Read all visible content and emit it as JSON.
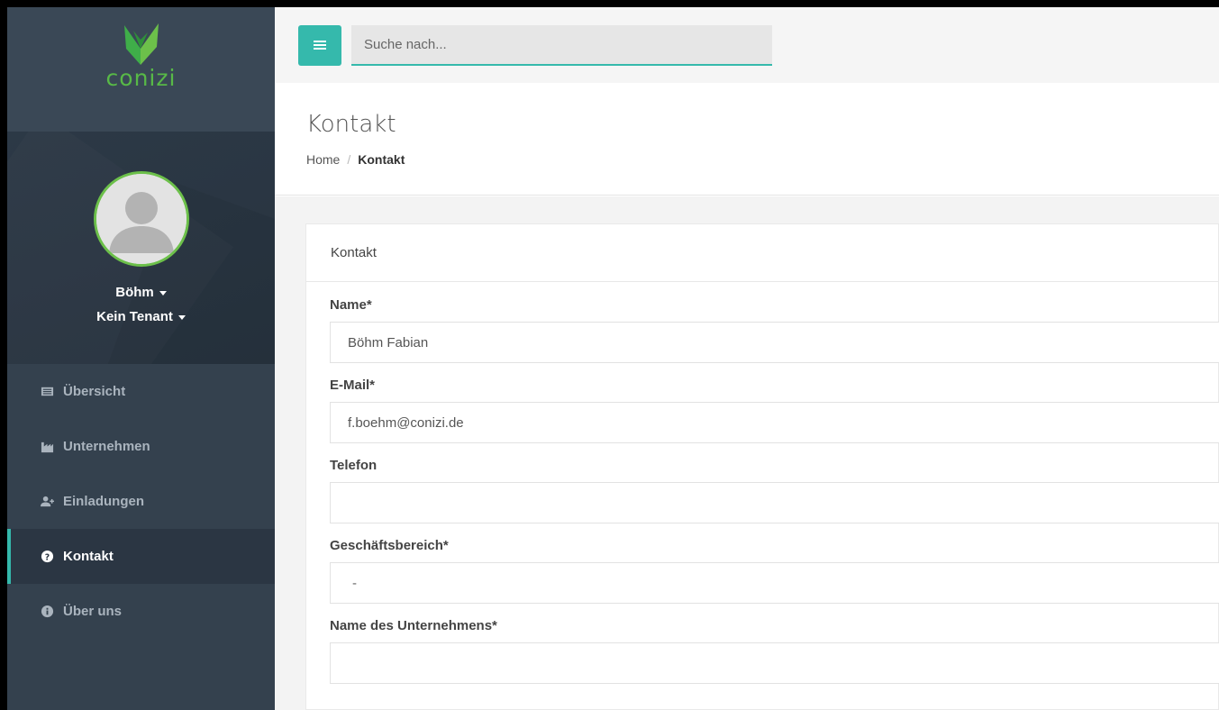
{
  "brand": {
    "name": "conizi"
  },
  "profile": {
    "name": "Böhm",
    "tenant": "Kein Tenant"
  },
  "sidebar": {
    "items": [
      {
        "label": "Übersicht",
        "icon": "list-icon",
        "active": false
      },
      {
        "label": "Unternehmen",
        "icon": "industry-icon",
        "active": false
      },
      {
        "label": "Einladungen",
        "icon": "user-plus-icon",
        "active": false
      },
      {
        "label": "Kontakt",
        "icon": "question-circle-icon",
        "active": true
      },
      {
        "label": "Über uns",
        "icon": "info-circle-icon",
        "active": false
      }
    ]
  },
  "topbar": {
    "search_placeholder": "Suche nach..."
  },
  "page": {
    "title": "Kontakt",
    "breadcrumb": {
      "home": "Home",
      "separator": "/",
      "current": "Kontakt"
    }
  },
  "card": {
    "title": "Kontakt"
  },
  "form": {
    "name": {
      "label": "Name*",
      "value": "Böhm Fabian"
    },
    "email": {
      "label": "E-Mail*",
      "value": "f.boehm@conizi.de"
    },
    "phone": {
      "label": "Telefon",
      "value": ""
    },
    "business": {
      "label": "Geschäftsbereich*",
      "value": "-"
    },
    "company": {
      "label": "Name des Unternehmens*",
      "value": ""
    }
  },
  "colors": {
    "accent": "#35b9ac",
    "brand_green": "#58b947",
    "sidebar_bg": "#34414e"
  }
}
